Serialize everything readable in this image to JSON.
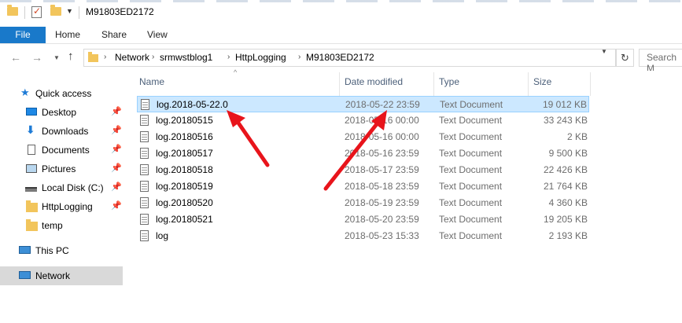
{
  "window": {
    "title": "M91803ED2172"
  },
  "ribbon": {
    "tabs": [
      "File",
      "Home",
      "Share",
      "View"
    ]
  },
  "address": {
    "breadcrumbs": [
      "Network",
      "srmwstblog1",
      "HttpLogging",
      "M91803ED2172"
    ],
    "search_placeholder": "Search M"
  },
  "sidebar": {
    "quick_access": "Quick access",
    "items": [
      "Desktop",
      "Downloads",
      "Documents",
      "Pictures",
      "Local Disk (C:)",
      "HttpLogging",
      "temp"
    ],
    "this_pc": "This PC",
    "network": "Network"
  },
  "columns": {
    "name": "Name",
    "date": "Date modified",
    "type": "Type",
    "size": "Size"
  },
  "files": [
    {
      "name": "log.2018-05-22.0",
      "date": "2018-05-22 23:59",
      "type": "Text Document",
      "size": "19 012 KB",
      "selected": true
    },
    {
      "name": "log.20180515",
      "date": "2018-05-16 00:00",
      "type": "Text Document",
      "size": "33 243 KB"
    },
    {
      "name": "log.20180516",
      "date": "2018-05-16 00:00",
      "type": "Text Document",
      "size": "2 KB"
    },
    {
      "name": "log.20180517",
      "date": "2018-05-16 23:59",
      "type": "Text Document",
      "size": "9 500 KB"
    },
    {
      "name": "log.20180518",
      "date": "2018-05-17 23:59",
      "type": "Text Document",
      "size": "22 426 KB"
    },
    {
      "name": "log.20180519",
      "date": "2018-05-18 23:59",
      "type": "Text Document",
      "size": "21 764 KB"
    },
    {
      "name": "log.20180520",
      "date": "2018-05-19 23:59",
      "type": "Text Document",
      "size": "4 360 KB"
    },
    {
      "name": "log.20180521",
      "date": "2018-05-20 23:59",
      "type": "Text Document",
      "size": "19 205 KB"
    },
    {
      "name": "log",
      "date": "2018-05-23 15:33",
      "type": "Text Document",
      "size": "2 193 KB"
    }
  ],
  "colors": {
    "accent": "#1979ca",
    "selection": "#cce8ff",
    "annotation_arrow": "#e8141b"
  }
}
